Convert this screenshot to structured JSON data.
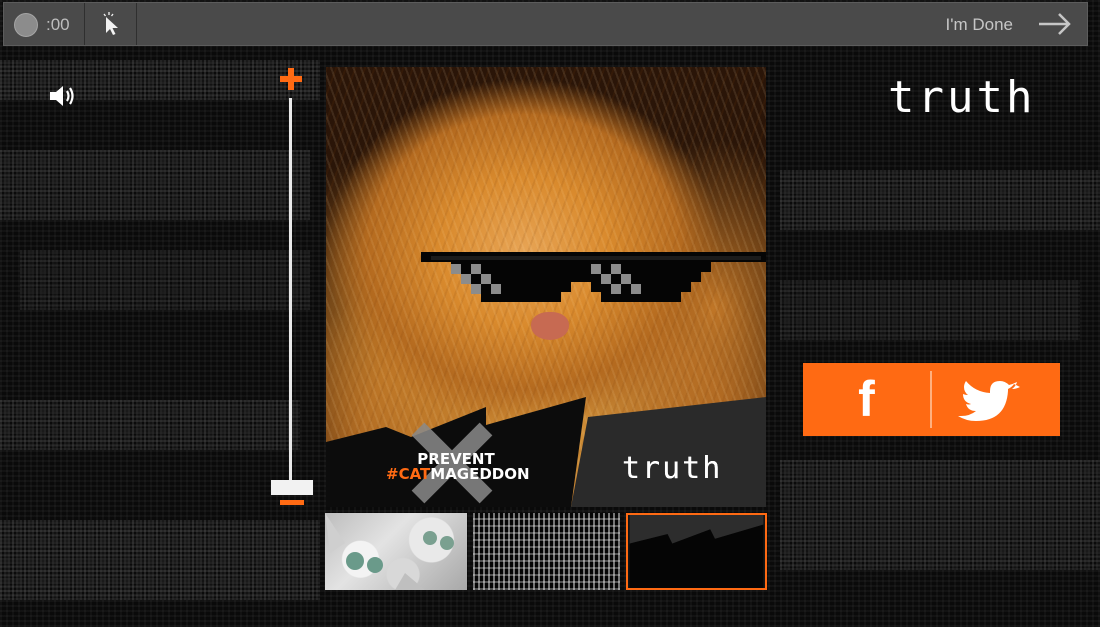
{
  "topbar": {
    "timer": ":00",
    "done_label": "I'm Done"
  },
  "brand": {
    "logo_text": "truth",
    "accent_color": "#ff6a13"
  },
  "canvas": {
    "banner_line1": "PREVENT",
    "banner_hash": "#CAT",
    "banner_rest": "MAGEDDON",
    "banner_logo": "truth"
  },
  "share": {
    "facebook_label": "f",
    "twitter_icon": "twitter-bird-icon"
  },
  "icons": {
    "record": "record-icon",
    "cursor": "cursor-icon",
    "arrow": "arrow-right-icon",
    "speaker": "speaker-icon",
    "plus": "plus-icon",
    "minus": "minus-icon"
  },
  "thumbnails": [
    {
      "name": "cats-pattern",
      "selected": false
    },
    {
      "name": "static-noise",
      "selected": false
    },
    {
      "name": "dark-stripe",
      "selected": true
    }
  ]
}
